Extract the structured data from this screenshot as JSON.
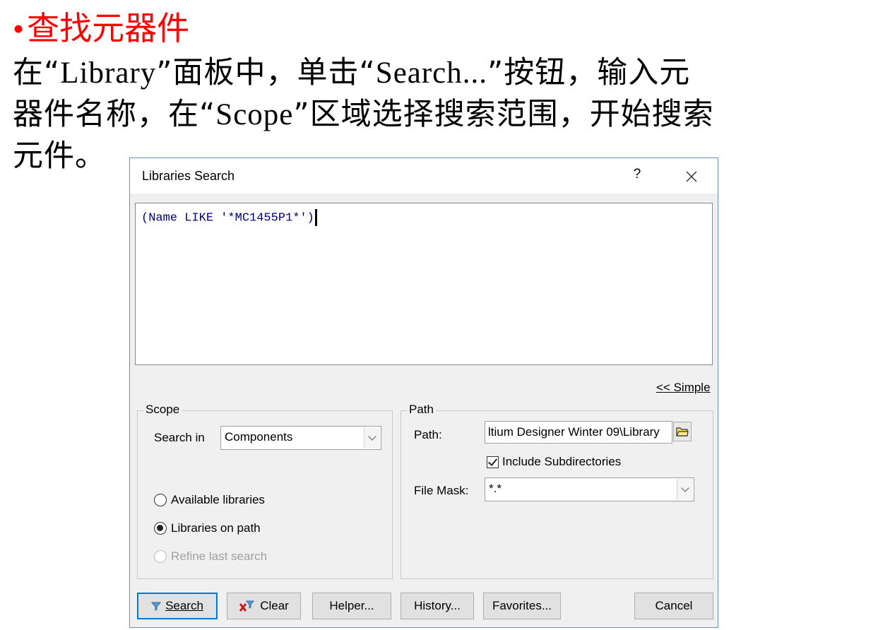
{
  "slide": {
    "bullet": "•",
    "title": "查找元器件",
    "line1_a": "在“",
    "line1_b": "Library",
    "line1_c": "”面板中，单击“",
    "line1_d": "Search...",
    "line1_e": "”按钮，输入元",
    "line2_a": "器件名称，在“",
    "line2_b": "Scope",
    "line2_c": "”区域选择搜索范围，开始搜索",
    "line3": "元件。"
  },
  "dialog": {
    "title": "Libraries Search",
    "help": "?",
    "close": "✕",
    "query": "(Name LIKE '*MC1455P1*')",
    "simple_link": "<< Simple",
    "scope": {
      "legend": "Scope",
      "search_in_label": "Search in",
      "search_in_value": "Components",
      "radio_available": "Available libraries",
      "radio_on_path": "Libraries on path",
      "radio_refine": "Refine last search"
    },
    "path": {
      "legend": "Path",
      "path_label": "Path:",
      "path_value": "ltium Designer Winter 09\\Library",
      "include_subdirs": "Include Subdirectories",
      "file_mask_label": "File Mask:",
      "file_mask_value": "*.*"
    },
    "buttons": {
      "search": "Search",
      "clear": "Clear",
      "helper": "Helper...",
      "history": "History...",
      "favorites": "Favorites...",
      "cancel": "Cancel"
    }
  }
}
